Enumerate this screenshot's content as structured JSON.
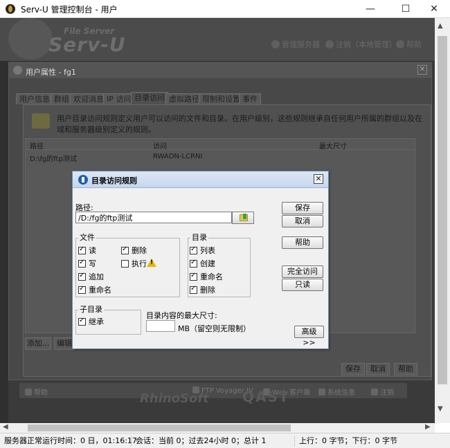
{
  "window": {
    "title": "Serv-U 管理控制台 - 用户",
    "controls": {
      "minimize": "—",
      "maximize": "☐",
      "close": "✕"
    }
  },
  "background_app": {
    "logo_sub": "File Server",
    "logo_main": "Serv-U",
    "top_links": [
      "管理服务器",
      "注销（本地管理）",
      "帮助"
    ],
    "footer_items": [
      "帮助",
      "FTP Voyager JV",
      "Web 客户端",
      "系统信息",
      "注销"
    ],
    "footer_logos": [
      "RhinoSoft",
      "QAST"
    ]
  },
  "user_dialog": {
    "title": "用户属性 - fg1",
    "tabs": [
      "用户信息",
      "群组",
      "欢迎消息",
      "IP 访问",
      "目录访问",
      "虚拟路径",
      "限制和设置",
      "事件"
    ],
    "active_tab": "目录访问",
    "description": "用户目录访问规则定义用户可以访问的文件和目录。在用户级别，这些规则继承自任何用户所属的群组以及在域和服务器级别定义的规则。",
    "table": {
      "headers": [
        "路径",
        "访问",
        "最大尺寸"
      ],
      "rows": [
        [
          "D:\\fg的ftp测试",
          "RWADN-LCRNI",
          ""
        ]
      ]
    },
    "bottom_buttons": [
      "添加...",
      "编辑"
    ],
    "footer_buttons": [
      "保存",
      "取消",
      "帮助"
    ]
  },
  "rule_dialog": {
    "title": "目录访问规则",
    "path_label": "路径:",
    "path_value": "/D:/fg的ftp测试",
    "buttons": {
      "save": "保存",
      "cancel": "取消",
      "help": "帮助",
      "full_access": "完全访问",
      "read_only": "只读",
      "advanced": "高级 >>"
    },
    "files_group": {
      "title": "文件",
      "items": [
        {
          "label": "读",
          "checked": true
        },
        {
          "label": "删除",
          "checked": true
        },
        {
          "label": "写",
          "checked": true
        },
        {
          "label": "执行",
          "checked": false
        },
        {
          "label": "追加",
          "checked": true
        },
        {
          "label": "重命名",
          "checked": true
        }
      ]
    },
    "dirs_group": {
      "title": "目录",
      "items": [
        {
          "label": "列表",
          "checked": true
        },
        {
          "label": "创建",
          "checked": true
        },
        {
          "label": "重命名",
          "checked": true
        },
        {
          "label": "删除",
          "checked": true
        }
      ]
    },
    "subdir_group": {
      "title": "子目录",
      "items": [
        {
          "label": "继承",
          "checked": true
        }
      ]
    },
    "max_size_label": "目录内容的最大尺寸:",
    "max_size_value": "",
    "max_size_unit": "MB（留空则无限制）"
  },
  "status_bar": {
    "uptime": "服务器正常运行时间：0 日，01:16:17",
    "sessions": "会话：当前 0；过去24小时 0；总计 1",
    "transfer": "上行：0 字节；下行：0 字节"
  },
  "colors": {
    "dialog_title_bg": "#c6d7ee",
    "dialog_border": "#6d8fb8",
    "backdrop": "#3a3a3a",
    "warning": "#e5b800"
  }
}
